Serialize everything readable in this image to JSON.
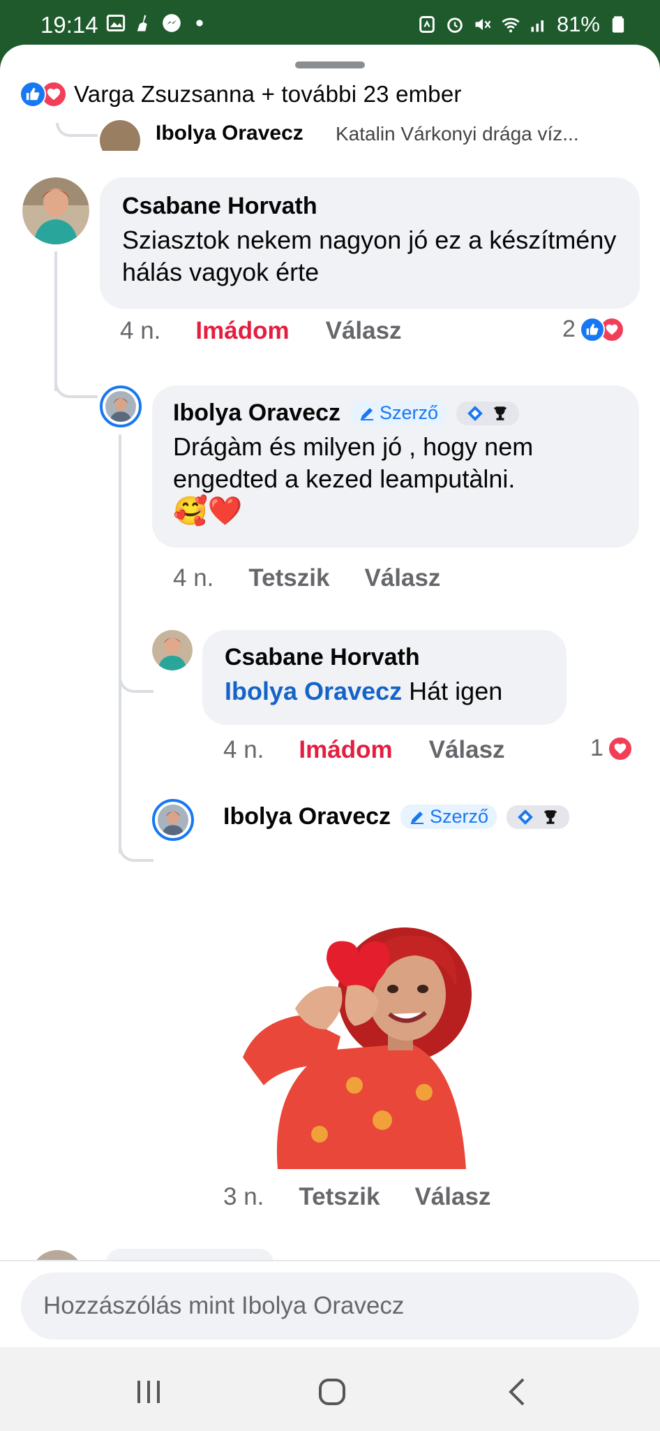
{
  "status_bar": {
    "time": "19:14",
    "battery": "81%",
    "left_icons": [
      "gallery-icon",
      "broom-icon",
      "messenger-icon",
      "dot-icon"
    ],
    "right_icons": [
      "nfc-icon",
      "alarm-icon",
      "mute-icon",
      "wifi-icon",
      "signal-icon",
      "battery-icon"
    ]
  },
  "header": {
    "reactors_text": "Varga Zsuzsanna + további 23 ember"
  },
  "cut_comment": {
    "author": "Ibolya Oravecz",
    "text": "Katalin Várkonyi drága víz..."
  },
  "comments": [
    {
      "author": "Csabane Horvath",
      "text": "Sziasztok nekem nagyon jó ez a készítmény hálás vagyok érte",
      "time": "4 n.",
      "reaction_label": "Imádom",
      "reply_label": "Válasz",
      "reaction_count": "2"
    }
  ],
  "replies": [
    {
      "author": "Ibolya Oravecz",
      "author_badge": "Szerző",
      "text": "Drágàm és milyen jó , hogy nem engedted a kezed leamputàlni.",
      "emojis": "🥰❤️",
      "time": "4 n.",
      "like_label": "Tetszik",
      "reply_label": "Válasz"
    },
    {
      "author": "Csabane Horvath",
      "mention": "Ibolya Oravecz",
      "text": "Hát igen",
      "time": "4 n.",
      "reaction_label": "Imádom",
      "reply_label": "Válasz",
      "reaction_count": "1"
    },
    {
      "author": "Ibolya Oravecz",
      "author_badge": "Szerző",
      "sticker": "heart-hands-avatar-sticker",
      "time": "3 n.",
      "like_label": "Tetszik",
      "reply_label": "Válasz"
    }
  ],
  "composer": {
    "placeholder": "Hozzászólás mint Ibolya Oravecz"
  },
  "colors": {
    "status_bar": "#1e5a2c",
    "love": "#e41e3f",
    "brand_blue": "#1877f2",
    "bubble": "#f0f2f5",
    "meta_text": "#65676b"
  }
}
